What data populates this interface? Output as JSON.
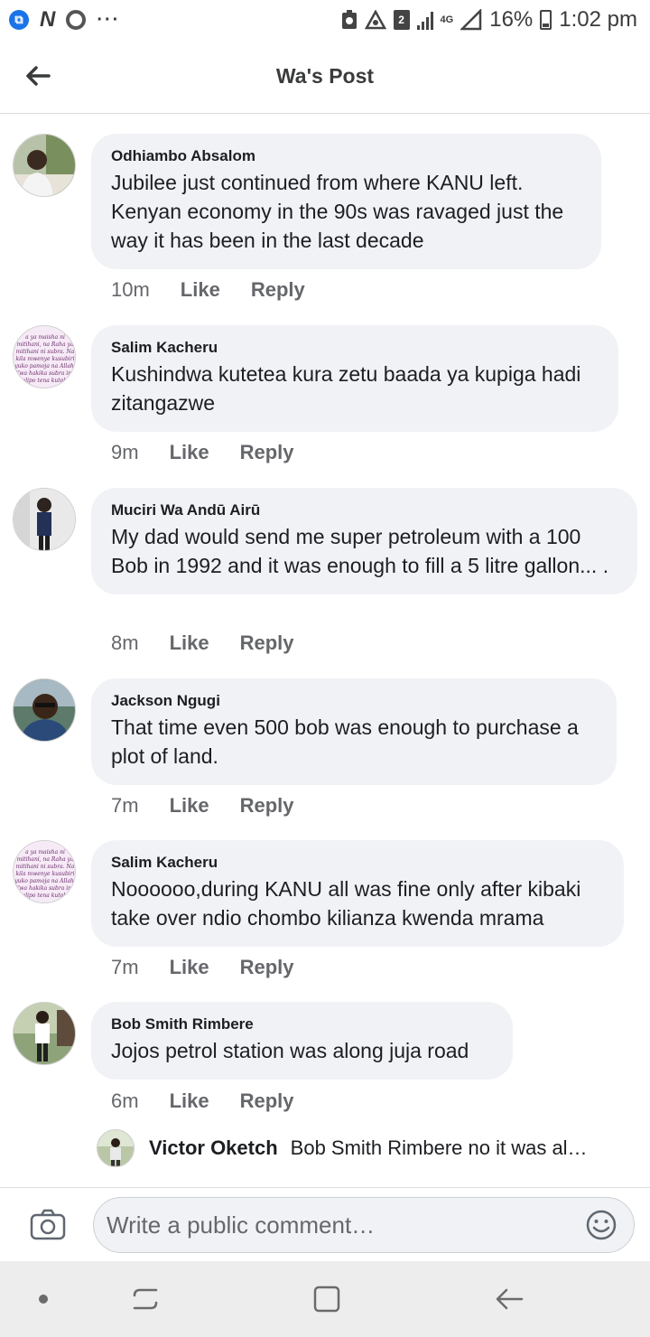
{
  "status_bar": {
    "app_icon_letter": "N",
    "more": "···",
    "sim": "2",
    "network": "4G",
    "battery": "16%",
    "time": "1:02 pm"
  },
  "header": {
    "title": "Wa's Post"
  },
  "comments": [
    {
      "author": "Odhiambo Absalom",
      "text": "Jubilee just continued from where KANU left. Kenyan economy in the 90s was ravaged just the way it has been in the last decade",
      "time": "10m",
      "like": "Like",
      "reply": "Reply"
    },
    {
      "author": "Salim Kacheru",
      "text": "Kushindwa kutetea kura zetu baada ya kupiga hadi zitangazwe",
      "time": "9m",
      "like": "Like",
      "reply": "Reply"
    },
    {
      "author": "Muciri Wa Andū Airū",
      "text": "My dad would send me super petroleum with a 100 Bob in 1992 and it was enough to fill a 5 litre gallon... .",
      "time": "8m",
      "like": "Like",
      "reply": "Reply"
    },
    {
      "author": "Jackson Ngugi",
      "text": "That time even 500 bob was enough to purchase a plot of land.",
      "time": "7m",
      "like": "Like",
      "reply": "Reply"
    },
    {
      "author": "Salim Kacheru",
      "text": "Noooooo,during KANU all was fine only after kibaki take over ndio chombo kilianza kwenda mrama",
      "time": "7m",
      "like": "Like",
      "reply": "Reply"
    },
    {
      "author": "Bob Smith Rimbere",
      "text": "Jojos petrol station was along juja road",
      "time": "6m",
      "like": "Like",
      "reply": "Reply"
    }
  ],
  "reply_preview": {
    "author": "Victor Oketch",
    "text": "Bob Smith Rimbere no it was al…"
  },
  "composer": {
    "placeholder": "Write a public comment…"
  },
  "avatar_text": {
    "salim": "a ya maisha ni mitihani, na Raha ya mitihani ni subra. Na kila mwenye kusubiri yuko pamoja na Allah. Ywa hakika subra ina mlipo tena kutoka Allah."
  }
}
